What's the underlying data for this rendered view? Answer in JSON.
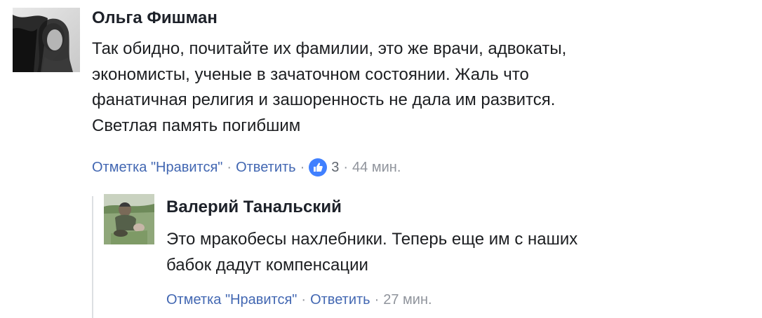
{
  "comment": {
    "author": "Ольга Фишман",
    "text_lines": [
      "Так обидно, почитайте их фамилии, это же врачи, адвокаты,",
      "экономисты, ученые в зачаточном состоянии. Жаль что",
      "фанатичная религия и зашоренность не дала им развится.",
      "Светлая память погибшим"
    ],
    "actions": {
      "like_label": "Отметка \"Нравится\"",
      "separator": "·",
      "reply_label": "Ответить",
      "reaction_icon": "thumbs-up-icon",
      "reaction_color": "#4080ff",
      "reaction_count": "3",
      "time": "44 мин."
    }
  },
  "reply": {
    "author": "Валерий Танальский",
    "text_lines": [
      "Это мракобесы нахлебники. Теперь еще им с наших",
      "бабок дадут компенсации"
    ],
    "actions": {
      "like_label": "Отметка \"Нравится\"",
      "separator": "·",
      "reply_label": "Ответить",
      "time": "27 мин."
    }
  },
  "colors": {
    "link": "#4267b2",
    "meta": "#90949c",
    "text": "#1c1e21",
    "thread_line": "#dddfe2"
  }
}
